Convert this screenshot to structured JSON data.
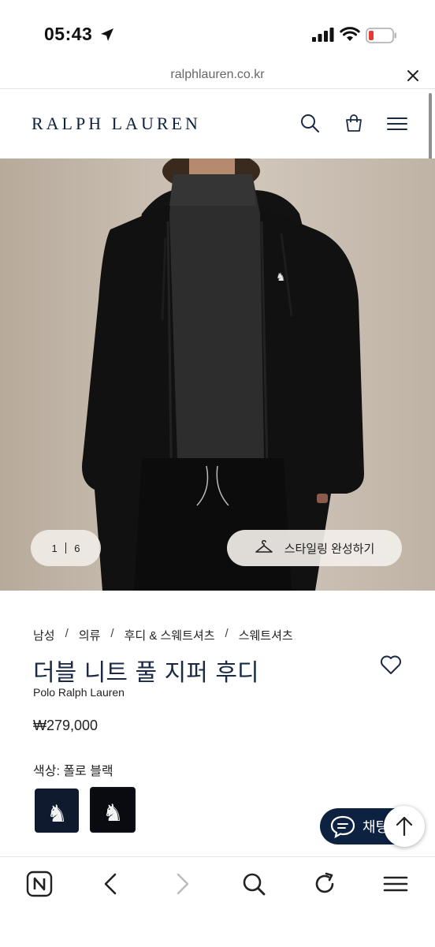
{
  "status_bar": {
    "time": "05:43"
  },
  "url_bar": {
    "domain": "ralphlauren.co.kr"
  },
  "header": {
    "logo": "RALPH LAUREN"
  },
  "hero": {
    "pager_current": "1",
    "pager_total": "6",
    "styling_label": "스타일링 완성하기"
  },
  "product": {
    "breadcrumb": [
      "남성",
      "의류",
      "후디 & 스웨트셔츠",
      "스웨트셔츠"
    ],
    "title": "더블 니트 풀 지퍼 후디",
    "brand": "Polo Ralph Lauren",
    "price": "₩279,000",
    "color_label": "색상: 폴로 블랙"
  },
  "chat": {
    "label": "채팅"
  },
  "icons": {
    "status": [
      "location-arrow-icon",
      "signal-icon",
      "wifi-icon",
      "battery-low-icon"
    ],
    "header": [
      "search-icon",
      "shopping-bag-icon",
      "hamburger-menu-icon"
    ],
    "toolbar": [
      "naver-home-icon",
      "back-arrow-icon",
      "forward-arrow-icon",
      "search-icon",
      "refresh-icon",
      "menu-icon"
    ]
  },
  "colors": {
    "brand_navy": "#0d2240",
    "battery_red": "#e53935"
  }
}
